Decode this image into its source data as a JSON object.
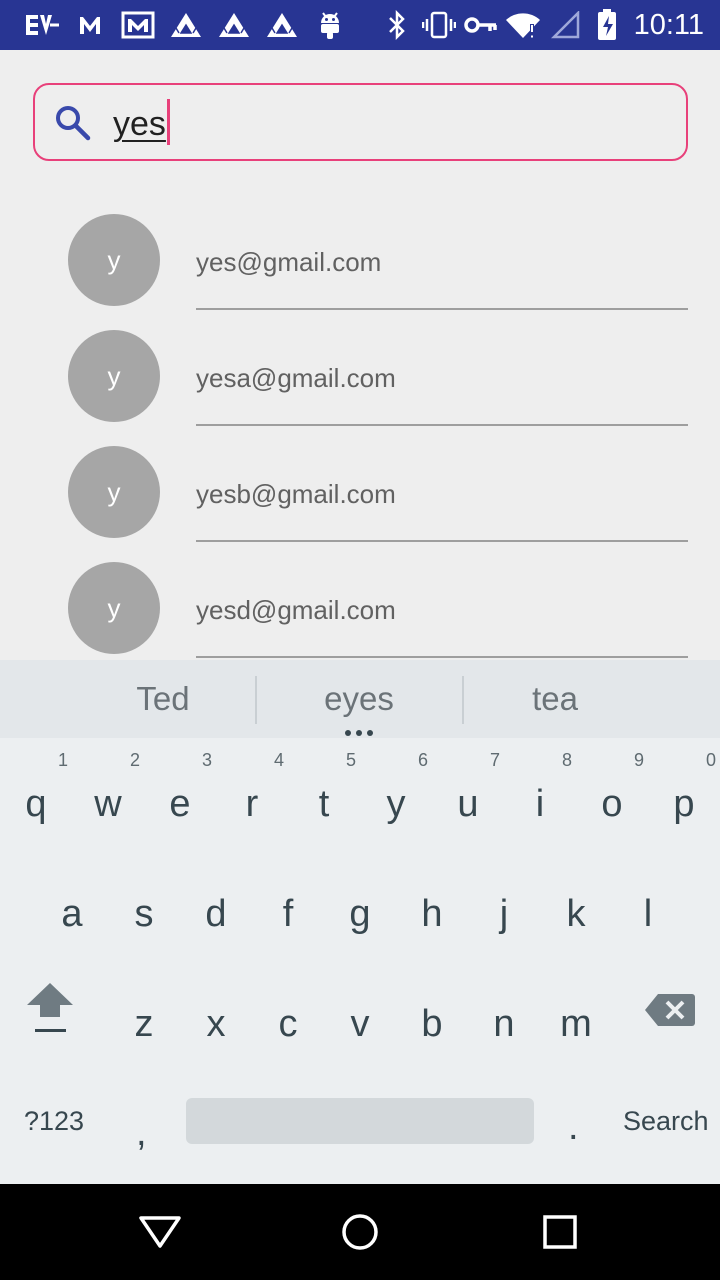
{
  "status_bar": {
    "time": "10:11",
    "left_icons": [
      "ev-icon",
      "gmail-m-icon",
      "mail-icon",
      "triangles-icon",
      "triangles-icon",
      "triangles-icon",
      "android-icon"
    ],
    "right_icons": [
      "bluetooth-icon",
      "vibrate-icon",
      "key-icon",
      "wifi-icon",
      "signal-icon",
      "battery-charging-icon"
    ]
  },
  "search": {
    "value": "yes"
  },
  "results": [
    {
      "avatar": "y",
      "email": "yes@gmail.com"
    },
    {
      "avatar": "y",
      "email": "yesa@gmail.com"
    },
    {
      "avatar": "y",
      "email": "yesb@gmail.com"
    },
    {
      "avatar": "y",
      "email": "yesd@gmail.com"
    }
  ],
  "keyboard": {
    "suggestions": [
      "Ted",
      "eyes",
      "tea"
    ],
    "row1": [
      {
        "key": "q",
        "hint": "1"
      },
      {
        "key": "w",
        "hint": "2"
      },
      {
        "key": "e",
        "hint": "3"
      },
      {
        "key": "r",
        "hint": "4"
      },
      {
        "key": "t",
        "hint": "5"
      },
      {
        "key": "y",
        "hint": "6"
      },
      {
        "key": "u",
        "hint": "7"
      },
      {
        "key": "i",
        "hint": "8"
      },
      {
        "key": "o",
        "hint": "9"
      },
      {
        "key": "p",
        "hint": "0"
      }
    ],
    "row2": [
      "a",
      "s",
      "d",
      "f",
      "g",
      "h",
      "j",
      "k",
      "l"
    ],
    "row3": [
      "z",
      "x",
      "c",
      "v",
      "b",
      "n",
      "m"
    ],
    "symbols_label": "?123",
    "comma": ",",
    "period": ".",
    "action_label": "Search"
  },
  "colors": {
    "status_bar": "#283593",
    "accent": "#e8407a",
    "search_icon": "#3949ab",
    "avatar": "#a6a6a6"
  }
}
